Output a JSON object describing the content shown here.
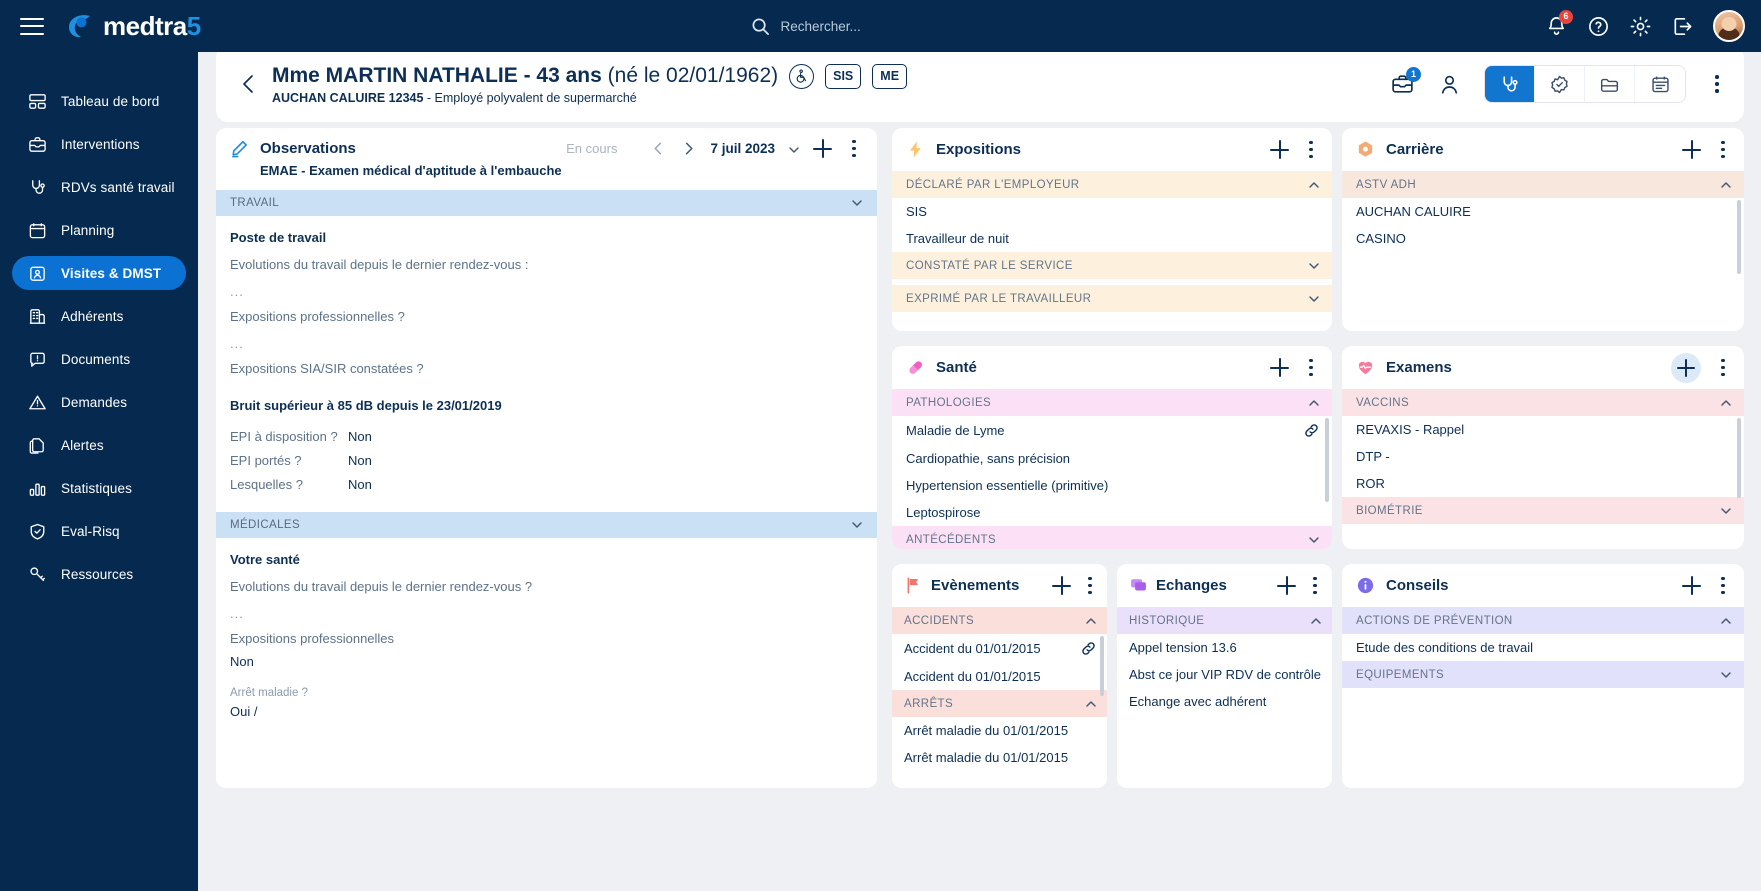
{
  "app": {
    "brand": "medtra",
    "brand_suffix": "5"
  },
  "topbar": {
    "search_placeholder": "Rechercher...",
    "notification_count": "6",
    "icons": [
      "menu-icon",
      "search-icon",
      "bell-icon",
      "help-icon",
      "gear-icon",
      "logout-icon",
      "avatar"
    ]
  },
  "sidebar": {
    "items": [
      {
        "label": "Tableau de bord",
        "icon": "dashboard-icon",
        "active": false
      },
      {
        "label": "Interventions",
        "icon": "briefcase-icon",
        "active": false
      },
      {
        "label": "RDVs santé travail",
        "icon": "stethoscope-icon",
        "active": false
      },
      {
        "label": "Planning",
        "icon": "calendar-icon",
        "active": false
      },
      {
        "label": "Visites & DMST",
        "icon": "id-card-icon",
        "active": true
      },
      {
        "label": "Adhérents",
        "icon": "building-icon",
        "active": false
      },
      {
        "label": "Documents",
        "icon": "message-alert-icon",
        "active": false
      },
      {
        "label": "Demandes",
        "icon": "warning-triangle-icon",
        "active": false
      },
      {
        "label": "Alertes",
        "icon": "copy-pages-icon",
        "active": false
      },
      {
        "label": "Statistiques",
        "icon": "bar-chart-icon",
        "active": false
      },
      {
        "label": "Eval-Risq",
        "icon": "shield-check-icon",
        "active": false
      },
      {
        "label": "Ressources",
        "icon": "key-icon",
        "active": false
      }
    ]
  },
  "patient_header": {
    "name_prefix": "Mme MARTIN NATHALIE - 43 ans",
    "name_suffix": "(né le 02/01/1962)",
    "company": "AUCHAN CALUIRE 12345",
    "job": "- Employé polyvalent de supermarché",
    "badges": [
      {
        "label": "",
        "icon": "wheelchair-icon",
        "shape": "circle"
      },
      {
        "label": "SIS",
        "shape": "square"
      },
      {
        "label": "ME",
        "shape": "square"
      }
    ],
    "briefcase_badge": "1",
    "segment_buttons": [
      {
        "icon": "stethoscope-icon",
        "active": true
      },
      {
        "icon": "badge-check-icon",
        "active": false
      },
      {
        "icon": "folder-icon",
        "active": false
      },
      {
        "icon": "calendar-list-icon",
        "active": false
      }
    ]
  },
  "observations": {
    "title": "Observations",
    "icon": "pencil-icon",
    "status": "En cours",
    "date": "7 juil 2023",
    "subtitle": "EMAE - Examen médical d'aptitude à l'embauche",
    "sections": [
      {
        "band": "TRAVAIL",
        "blocks": [
          {
            "type": "heading",
            "text": "Poste de travail"
          },
          {
            "type": "question",
            "text": "Evolutions du travail depuis le dernier rendez-vous :"
          },
          {
            "type": "dots",
            "text": "..."
          },
          {
            "type": "question",
            "text": "Expositions professionnelles ?"
          },
          {
            "type": "dots",
            "text": "..."
          },
          {
            "type": "question",
            "text": "Expositions SIA/SIR constatées ?"
          },
          {
            "type": "heading",
            "text": "Bruit supérieur à 85 dB depuis le 23/01/2019"
          },
          {
            "type": "kv",
            "key": "EPI à disposition ?",
            "value": "Non"
          },
          {
            "type": "kv",
            "key": "EPI portés ?",
            "value": "Non"
          },
          {
            "type": "kv",
            "key": "Lesquelles ?",
            "value": "Non"
          }
        ]
      },
      {
        "band": "MÉDICALES",
        "blocks": [
          {
            "type": "heading",
            "text": "Votre santé"
          },
          {
            "type": "question",
            "text": "Evolutions du travail depuis le dernier rendez-vous ?"
          },
          {
            "type": "dots",
            "text": "..."
          },
          {
            "type": "question",
            "text": "Expositions professionnelles"
          },
          {
            "type": "answer",
            "text": "Non"
          },
          {
            "type": "smallq",
            "text": "Arrêt maladie ?"
          },
          {
            "type": "answer",
            "text": "Oui /"
          }
        ]
      }
    ]
  },
  "cards": {
    "expositions": {
      "title": "Expositions",
      "icon": "lightning-icon",
      "accent": "#ffd089",
      "band_bg": "#fdf1dd",
      "sections": [
        {
          "label": "DÉCLARÉ PAR L'EMPLOYEUR",
          "open": true,
          "items": [
            "SIS",
            "Travailleur de nuit"
          ]
        },
        {
          "label": "CONSTATÉ PAR LE SERVICE",
          "open": false,
          "items": []
        },
        {
          "label": "EXPRIMÉ PAR LE TRAVAILLEUR",
          "open": false,
          "items": []
        }
      ]
    },
    "carriere": {
      "title": "Carrière",
      "icon": "hexagon-icon",
      "accent": "#f0a868",
      "band_bg": "#f8e7dd",
      "sections": [
        {
          "label": "ASTV ADH",
          "open": true,
          "items": [
            "AUCHAN CALUIRE",
            "CASINO"
          ]
        }
      ]
    },
    "sante": {
      "title": "Santé",
      "icon": "pill-icon",
      "accent": "#ef5fc0",
      "band_bg": "#fce0f5",
      "sections": [
        {
          "label": "PATHOLOGIES",
          "open": true,
          "items": [
            "Maladie de Lyme",
            "Cardiopathie, sans précision",
            "Hypertension essentielle (primitive)",
            "Leptospirose"
          ]
        },
        {
          "label": "ANTÉCÉDENTS",
          "open": false,
          "items": []
        }
      ],
      "linked_row_index": 0
    },
    "examens": {
      "title": "Examens",
      "icon": "heart-pulse-icon",
      "accent": "#f77a9e",
      "band_bg": "#fbe2e4",
      "sections": [
        {
          "label": "VACCINS",
          "open": true,
          "items": [
            "REVAXIS - Rappel",
            "DTP -",
            "ROR"
          ]
        },
        {
          "label": "BIOMÉTRIE",
          "open": false,
          "items": []
        }
      ]
    },
    "evenements": {
      "title": "Evènements",
      "icon": "flag-icon",
      "accent": "#f4736c",
      "band_bg": "#fbdfdb",
      "sections": [
        {
          "label": "ACCIDENTS",
          "open": true,
          "items": [
            "Accident du 01/01/2015",
            "Accident du 01/01/2015"
          ]
        },
        {
          "label": "ARRÊTS",
          "open": true,
          "items": [
            "Arrêt maladie du 01/01/2015",
            "Arrêt maladie du 01/01/2015"
          ]
        }
      ],
      "linked_row_index": 0
    },
    "echanges": {
      "title": "Echanges",
      "icon": "chat-icon",
      "accent": "#a85fe8",
      "band_bg": "#ebe0fb",
      "sections": [
        {
          "label": "HISTORIQUE",
          "open": true,
          "items": [
            "Appel tension 13.6",
            "Abst ce jour VIP RDV de contrôle",
            "Echange avec adhérent"
          ]
        }
      ]
    },
    "conseils": {
      "title": "Conseils",
      "icon": "info-icon",
      "accent": "#7b6ce8",
      "band_bg": "#e2e1fb",
      "sections": [
        {
          "label": "ACTIONS DE PRÉVENTION",
          "open": true,
          "items": [
            "Etude des conditions de travail"
          ]
        },
        {
          "label": "EQUIPEMENTS",
          "open": false,
          "items": []
        }
      ]
    }
  }
}
